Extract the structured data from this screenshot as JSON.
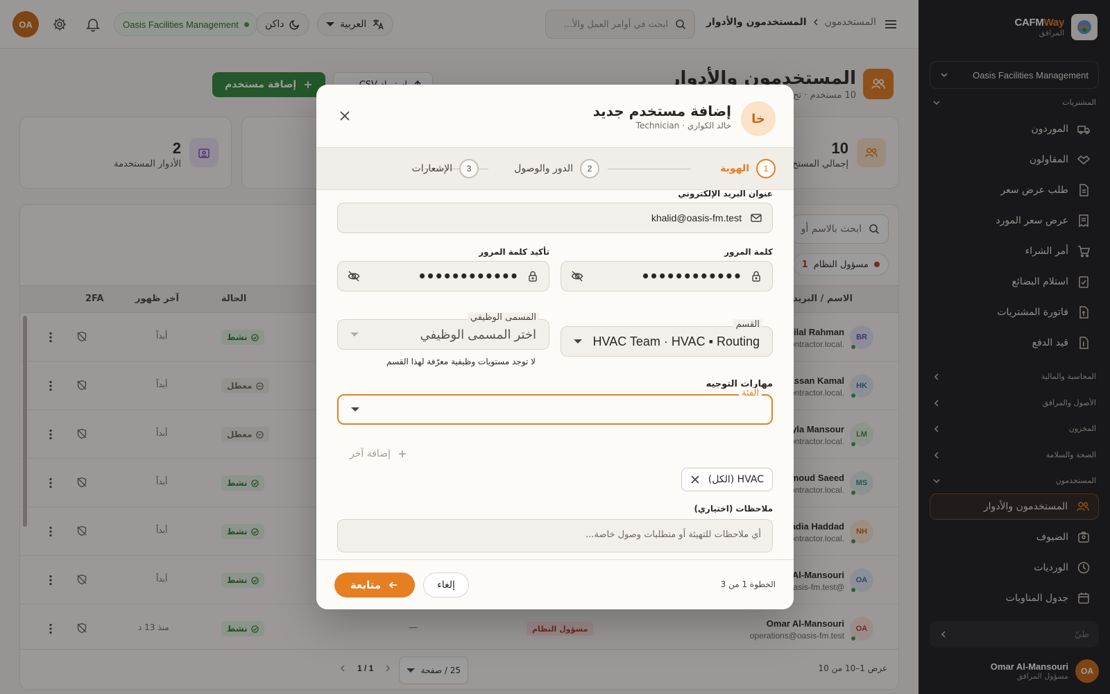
{
  "sidebar": {
    "brand_cafm": "CAFM",
    "brand_way": "Way",
    "brand_sub": "المرافق",
    "org": "Oasis Facilities Management",
    "section_procurement": "المشتريات",
    "procurement_items": [
      "الموردون",
      "المقاولون",
      "طلب عرض سعر",
      "عرض سعر المورد",
      "أمر الشراء",
      "استلام البضائع",
      "فاتورة المشتريات",
      "قيد الدفع"
    ],
    "section_accounting": "المحاسبة والمالية",
    "section_assets": "الأصول والمرافق",
    "section_inventory": "المخزون",
    "section_safety": "الصحة والسلامة",
    "section_users": "المستخدمون",
    "users_items": [
      "المستخدمون والأدوار",
      "الضيوف",
      "الورديات",
      "جدول المناوبات"
    ],
    "collapse_placeholder": "طيّ",
    "user_initials": "OA",
    "user_name": "Omar Al-Mansouri",
    "user_role": "مسؤول المرافق"
  },
  "topbar": {
    "avatar": "OA",
    "org_badge": "Oasis Facilities Management",
    "theme_label": "داكن",
    "lang_label": "العربية",
    "search_placeholder": "ابحث في أوامر العمل والأ...",
    "breadcrumb_parent": "المستخدمون",
    "breadcrumb_current": "المستخدمون والأدوار"
  },
  "page": {
    "title": "المستخدمون والأدوار",
    "subtitle": "10 مستخدم · تح",
    "add_user": "إضافة مستخدم",
    "import_csv": "استيراد CSV",
    "stats": [
      {
        "value": "10",
        "label": "إجمالي المستخ"
      },
      {
        "value": "2",
        "label": "الأدوار المستخدمة"
      }
    ],
    "table_search_placeholder": "ابحث بالاسم أو",
    "role_filter": {
      "label": "مسؤول النظام",
      "count": "1"
    },
    "columns": {
      "name": "الاسم / البريد",
      "status": "الحالة",
      "last_seen": "آخر ظهور",
      "tfa": "2FA"
    },
    "rows": [
      {
        "initials": "BR",
        "name": "Bilal Rahman",
        "email": ".contractor.local",
        "status": "نشط",
        "last_seen": "أبداً",
        "color": "#e6e4f5",
        "fg": "#5b4fb8"
      },
      {
        "initials": "HK",
        "name": "Hassan Kamal",
        "email": ".contractor.local",
        "status": "معطل",
        "last_seen": "أبداً",
        "color": "#e2ebf5",
        "fg": "#3a6aa8"
      },
      {
        "initials": "LM",
        "name": "Layla Mansour",
        "email": ".contractor.local",
        "status": "معطل",
        "last_seen": "أبداً",
        "color": "#e3f1e3",
        "fg": "#3f8a47"
      },
      {
        "initials": "MS",
        "name": "ahmoud Saeed",
        "email": ".contractor.local",
        "status": "نشط",
        "last_seen": "أبداً",
        "color": "#e0f0ee",
        "fg": "#2f8a80"
      },
      {
        "initials": "NH",
        "name": "Nadia Haddad",
        "email": ".contractor.local",
        "status": "نشط",
        "last_seen": "أبداً",
        "color": "#fbe8d6",
        "fg": "#c86a16"
      },
      {
        "initials": "OA",
        "name": "ar Al-Mansouri",
        "email": "@oasis-fm.test",
        "status": "نشط",
        "last_seen": "أبداً",
        "color": "#e2ebf5",
        "fg": "#3a6aa8"
      },
      {
        "initials": "OA",
        "name": "Omar Al-Mansouri",
        "email": "operations@oasis-fm.test",
        "status": "نشط",
        "last_seen": "منذ 13 د",
        "color": "#fbe3e0",
        "fg": "#b03a2e",
        "role": "مسؤول النظام",
        "dash": "—"
      }
    ],
    "footer_count": "عرض 1–10 من 10",
    "per_page": "25 / صفحة",
    "pagination": "1 / 1"
  },
  "modal": {
    "avatar": "خا",
    "title": "إضافة مستخدم جديد",
    "subtitle": "خالد الكواري · Technician",
    "steps": [
      {
        "num": "1",
        "label": "الهوية"
      },
      {
        "num": "2",
        "label": "الدور والوصول"
      },
      {
        "num": "3",
        "label": "الإشعارات"
      }
    ],
    "email_label": "عنوان البريد الإلكتروني",
    "email_value": "khalid@oasis-fm.test",
    "password_label": "كلمة المرور",
    "password_value": "••••••••••••",
    "confirm_label": "تأكيد كلمة المرور",
    "confirm_value": "••••••••••••",
    "department_label": "القسم",
    "department_value": "HVAC Team · HVAC ▪ Routing",
    "job_title_label": "المسمى الوظيفي",
    "job_title_placeholder": "اختر المسمى الوظيفي",
    "job_title_hint": "لا توجد مستويات وظيفية معرّفة لهذا القسم",
    "routing_label": "مهارات التوجيه",
    "category_label": "الفئة",
    "add_another": "إضافة آخر",
    "chip_value": "HVAC (الكل)",
    "notes_label": "ملاحظات (اختياري)",
    "notes_placeholder": "أي ملاحظات للتهيئة أو متطلبات وصول خاصة...",
    "step_counter": "الخطوة 1 من 3",
    "cancel": "إلغاء",
    "continue": "متابعة"
  },
  "colors": {
    "accent": "#e67e22",
    "success": "#2f8a3c",
    "sidebar_bg": "#1b1b1e"
  }
}
